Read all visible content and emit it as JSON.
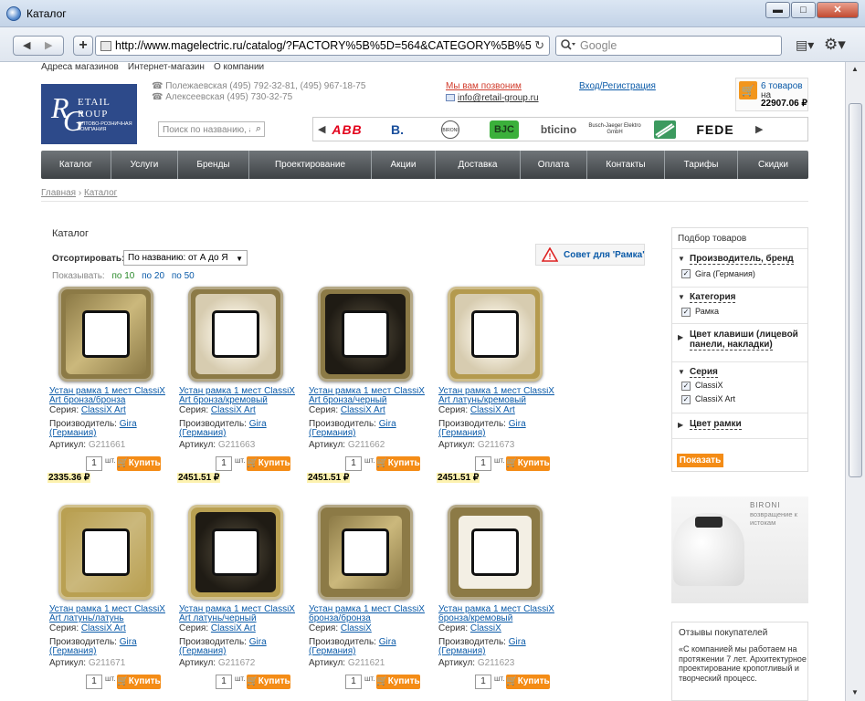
{
  "window": {
    "title": "Каталог",
    "btn_min": "▬",
    "btn_max": "□",
    "btn_close": "✕"
  },
  "toolbar": {
    "back": "◀",
    "forward": "▶",
    "new_tab": "+",
    "url": "http://www.magelectric.ru/catalog/?FACTORY%5B%5D=564&CATEGORY%5B%5D=6",
    "reload": "↻",
    "search_placeholder": "Google",
    "search_icon": "magnifier-dropdown-icon",
    "page_icon": "▤▾",
    "gear_icon": "⚙▾"
  },
  "topnav": [
    "Адреса магазинов",
    "Интернет-магазин",
    "О компании"
  ],
  "logo": {
    "r": "R",
    "g": "G",
    "retail": "ETAIL",
    "group": "ROUP",
    "sub": "ОПТОВО-РОЗНИЧНАЯ КОМПАНИЯ"
  },
  "contacts": {
    "phone1": "Полежаевская (495) 792-32-81, (495) 967-18-75",
    "phone2": "Алексеевская (495) 730-32-75",
    "callback": "Мы вам позвоним",
    "email": "info@retail-group.ru",
    "login": "Вход/Регистрация"
  },
  "cart": {
    "line1": "6 товаров",
    "line2": "на",
    "total": "22907.06 ₽"
  },
  "site_search": {
    "placeholder": "Поиск по названию, ар"
  },
  "brands": [
    "ABB",
    "B.",
    "BIRONI",
    "BJC",
    "bticino",
    "Busch-Jaeger Elektro GmbH",
    "",
    "FEDE"
  ],
  "mainnav": [
    "Каталог",
    "Услуги",
    "Бренды",
    "Проектирование",
    "Акции",
    "Доставка",
    "Оплата",
    "Контакты",
    "Тарифы",
    "Скидки"
  ],
  "breadcrumb": {
    "home": "Главная",
    "sep": "›",
    "current": "Каталог"
  },
  "catalog": {
    "title": "Каталог",
    "sort_label": "Отсортировать:",
    "sort_value": "По названию: от А до Я",
    "show_label": "Показывать:",
    "show_options": [
      "по 10",
      "по 20",
      "по 50"
    ],
    "advice": "Совет для 'Рамка'",
    "labels": {
      "series": "Серия:",
      "maker": "Производитель:",
      "sku": "Артикул:",
      "unit": "шт.",
      "buy": "Купить"
    },
    "products": [
      {
        "title1": "Устан рамка 1 мест ClassiX",
        "title2": "Art бронза/бронза",
        "series": "ClassiX Art",
        "maker1": "Gira",
        "maker2": "(Германия)",
        "sku": "G211661",
        "qty": "1",
        "price": "2335.36 ₽",
        "frame": "#8c7a46",
        "pat": "none"
      },
      {
        "title1": "Устан рамка 1 мест ClassiX",
        "title2": "Art бронза/кремовый",
        "series": "ClassiX Art",
        "maker1": "Gira",
        "maker2": "(Германия)",
        "sku": "G211663",
        "qty": "1",
        "price": "2451.51 ₽",
        "frame": "#8c7a46",
        "pat": "cream"
      },
      {
        "title1": "Устан рамка 1 мест ClassiX",
        "title2": "Art бронза/черный",
        "series": "ClassiX Art",
        "maker1": "Gira",
        "maker2": "(Германия)",
        "sku": "G211662",
        "qty": "1",
        "price": "2451.51 ₽",
        "frame": "#8c7a46",
        "pat": "black"
      },
      {
        "title1": "Устан рамка 1 мест ClassiX",
        "title2": "Art латунь/кремовый",
        "series": "ClassiX Art",
        "maker1": "Gira",
        "maker2": "(Германия)",
        "sku": "G211673",
        "qty": "1",
        "price": "2451.51 ₽",
        "frame": "#b49a4e",
        "pat": "cream"
      },
      {
        "title1": "Устан рамка 1 мест ClassiX",
        "title2": "Art латунь/латунь",
        "series": "ClassiX Art",
        "maker1": "Gira",
        "maker2": "(Германия)",
        "sku": "G211671",
        "qty": "1",
        "price": "",
        "frame": "#b9a052",
        "pat": "none"
      },
      {
        "title1": "Устан рамка 1 мест ClassiX",
        "title2": "Art латунь/черный",
        "series": "ClassiX Art",
        "maker1": "Gira",
        "maker2": "(Германия)",
        "sku": "G211672",
        "qty": "1",
        "price": "",
        "frame": "#b9a052",
        "pat": "black"
      },
      {
        "title1": "Устан рамка 1 мест ClassiX",
        "title2": "бронза/бронза",
        "series": "ClassiX",
        "maker1": "Gira",
        "maker2": "(Германия)",
        "sku": "G211621",
        "qty": "1",
        "price": "",
        "frame": "#8c7a46",
        "pat": "plainbronze"
      },
      {
        "title1": "Устан рамка 1 мест ClassiX",
        "title2": "бронза/кремовый",
        "series": "ClassiX",
        "maker1": "Gira",
        "maker2": "(Германия)",
        "sku": "G211623",
        "qty": "1",
        "price": "",
        "frame": "#8c7a46",
        "pat": "plaincream"
      }
    ]
  },
  "filter": {
    "heading": "Подбор товаров",
    "sections": [
      {
        "title": "Производитель, бренд",
        "open": true,
        "items": [
          "Gira (Германия)"
        ]
      },
      {
        "title": "Категория",
        "open": true,
        "items": [
          "Рамка"
        ]
      },
      {
        "title": "Цвет клавиши (лицевой",
        "title2": "панели, накладки)",
        "open": false,
        "items": []
      },
      {
        "title": "Серия",
        "open": true,
        "items": [
          "ClassiX",
          "ClassiX Art"
        ]
      },
      {
        "title": "Цвет рамки",
        "open": false,
        "items": []
      }
    ],
    "show_button": "Показать"
  },
  "banner": {
    "brand": "BIRONI",
    "text": "возвращение к истокам"
  },
  "reviews": {
    "heading": "Отзывы покупателей",
    "text": "«С компанией мы работаем на протяжении 7 лет. Архитектурное проектирование кропотливый и творческий процесс."
  }
}
